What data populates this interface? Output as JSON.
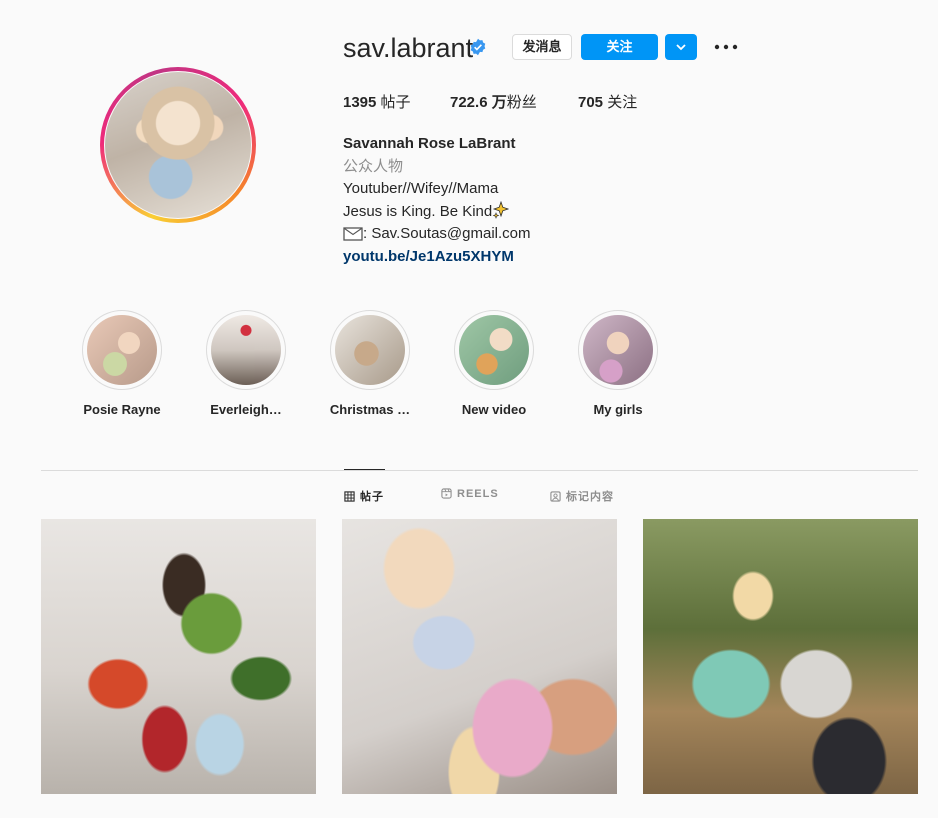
{
  "profile": {
    "username": "sav.labrant",
    "verified": true,
    "buttons": {
      "message": "发消息",
      "follow": "关注"
    },
    "stats": {
      "posts": "1395",
      "posts_label": " 帖子",
      "followers": "722.6 万",
      "followers_label": "粉丝",
      "following": "705",
      "following_label": " 关注"
    },
    "bio": {
      "full_name": "Savannah Rose LaBrant",
      "category": "公众人物",
      "line1": "Youtuber//Wifey//Mama",
      "line2": "Jesus is King. Be Kind",
      "line3": ": Sav.Soutas@gmail.com",
      "link": "youtu.be/Je1Azu5XHYM"
    }
  },
  "highlights": [
    {
      "label": "Posie Rayne"
    },
    {
      "label": "Everleigh…"
    },
    {
      "label": "Christmas …"
    },
    {
      "label": "New video"
    },
    {
      "label": "My girls"
    }
  ],
  "tabs": {
    "posts": "帖子",
    "reels": "REELS",
    "tagged": "标记内容"
  },
  "colors": {
    "accent": "#0095f6",
    "link": "#00376b",
    "muted": "#8e8e8e",
    "text": "#262626",
    "background": "#fafafa"
  },
  "icons": [
    "verified-badge-icon",
    "chevron-down-icon",
    "more-options-icon",
    "envelope-icon",
    "sparkles-icon",
    "grid-icon",
    "reels-icon",
    "tagged-icon"
  ]
}
